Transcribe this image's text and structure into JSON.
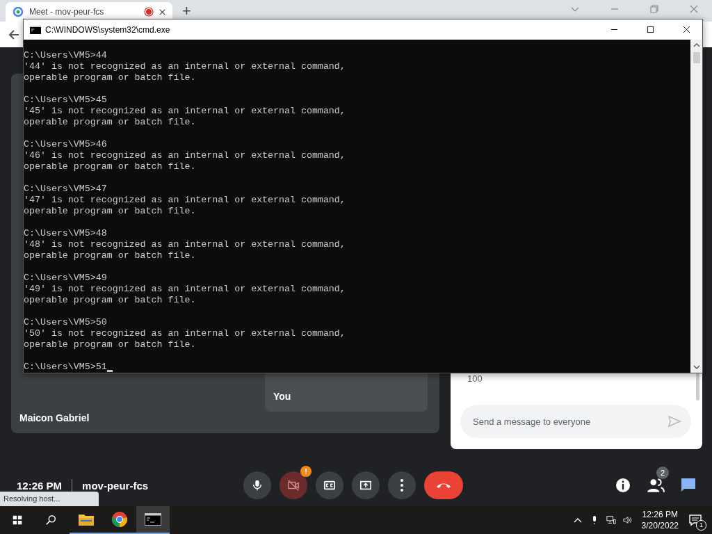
{
  "browser": {
    "tab": {
      "title": "Meet - mov-peur-fcs",
      "recording": true,
      "selected": true
    },
    "new_tab": "+"
  },
  "cmd": {
    "title": "C:\\WINDOWS\\system32\\cmd.exe",
    "cursor": true,
    "blocks": [
      {
        "lines": [
          "C:\\Users\\VM5>44",
          "'44' is not recognized as an internal or external command,",
          "operable program or batch file."
        ]
      },
      {
        "lines": [
          "C:\\Users\\VM5>45",
          "'45' is not recognized as an internal or external command,",
          "operable program or batch file."
        ]
      },
      {
        "lines": [
          "C:\\Users\\VM5>46",
          "'46' is not recognized as an internal or external command,",
          "operable program or batch file."
        ]
      },
      {
        "lines": [
          "C:\\Users\\VM5>47",
          "'47' is not recognized as an internal or external command,",
          "operable program or batch file."
        ]
      },
      {
        "lines": [
          "C:\\Users\\VM5>48",
          "'48' is not recognized as an internal or external command,",
          "operable program or batch file."
        ]
      },
      {
        "lines": [
          "C:\\Users\\VM5>49",
          "'49' is not recognized as an internal or external command,",
          "operable program or batch file."
        ]
      },
      {
        "lines": [
          "C:\\Users\\VM5>50",
          "'50' is not recognized as an internal or external command,",
          "operable program or batch file."
        ]
      },
      {
        "lines": [
          "C:\\Users\\VM5>51"
        ]
      }
    ]
  },
  "meet": {
    "participants": [
      {
        "name": "Maicon Gabriel"
      },
      {
        "name": "You"
      }
    ],
    "chat": {
      "messages": [
        "100"
      ],
      "placeholder": "Send a message to everyone"
    },
    "time": "12:26 PM",
    "code": "mov-peur-fcs",
    "controls": [
      {
        "kind": "mic",
        "off": false
      },
      {
        "kind": "camera",
        "off": true,
        "alert": "!"
      },
      {
        "kind": "captions",
        "off": false
      },
      {
        "kind": "present",
        "off": false
      },
      {
        "kind": "more",
        "off": false
      },
      {
        "kind": "leave",
        "off": false
      }
    ],
    "people_count": "2"
  },
  "status": "Resolving host...",
  "taskbar": {
    "apps": [
      {
        "kind": "explorer",
        "selected": false
      },
      {
        "kind": "chrome",
        "selected": false
      },
      {
        "kind": "cmd",
        "selected": true
      }
    ],
    "time": "12:26 PM",
    "date": "3/20/2022",
    "notifications": "1"
  }
}
